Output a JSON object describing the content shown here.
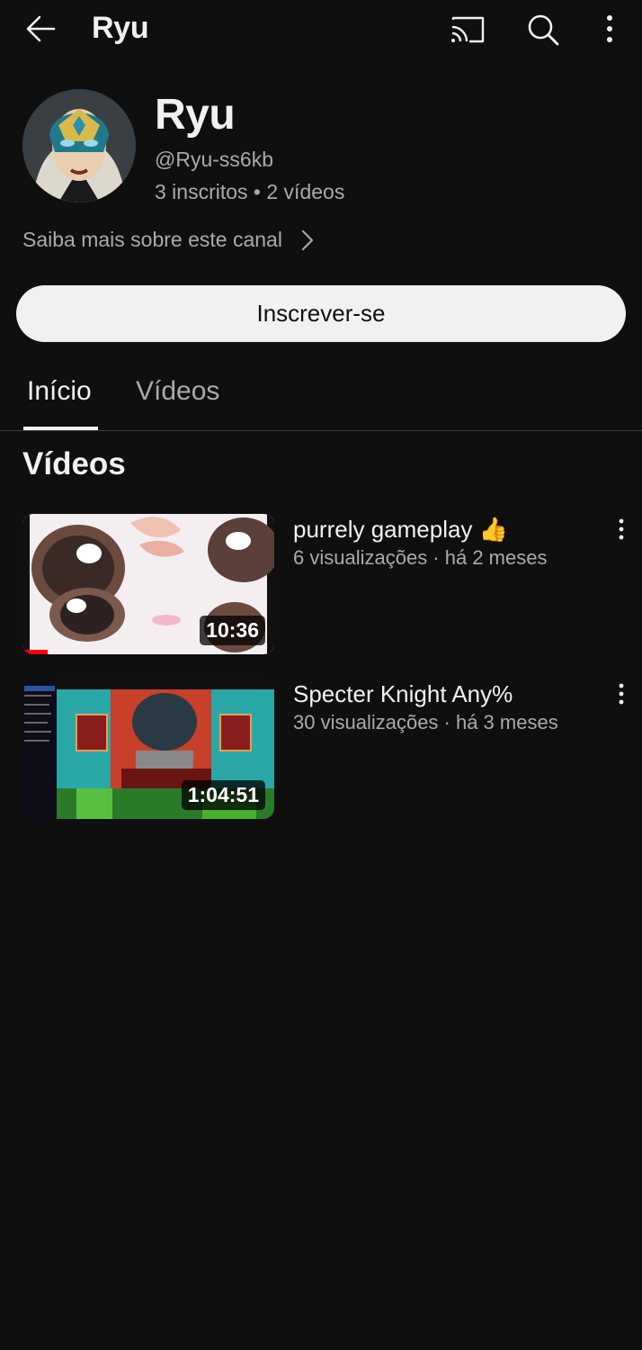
{
  "topbar": {
    "title": "Ryu",
    "icons": [
      "back-arrow-icon",
      "cast-icon",
      "search-icon",
      "more-vert-icon"
    ]
  },
  "channel": {
    "name": "Ryu",
    "handle": "@Ryu-ss6kb",
    "stats": "3 inscritos • 2 vídeos",
    "about_link": "Saiba mais sobre este canal",
    "subscribe_label": "Inscrever-se"
  },
  "tabs": [
    {
      "label": "Início",
      "active": true
    },
    {
      "label": "Vídeos",
      "active": false
    }
  ],
  "section": {
    "title": "Vídeos"
  },
  "videos": [
    {
      "title": "purrely gameplay 👍",
      "meta": "6 visualizações · há 2 meses",
      "duration": "10:36"
    },
    {
      "title": "Specter Knight Any%",
      "meta": "30 visualizações · há 3 meses",
      "duration": "1:04:51"
    }
  ],
  "colors": {
    "background": "#0f0f0f",
    "text_primary": "#f1f1f1",
    "text_secondary": "#aaaaaa",
    "progress_red": "#ff0000"
  }
}
